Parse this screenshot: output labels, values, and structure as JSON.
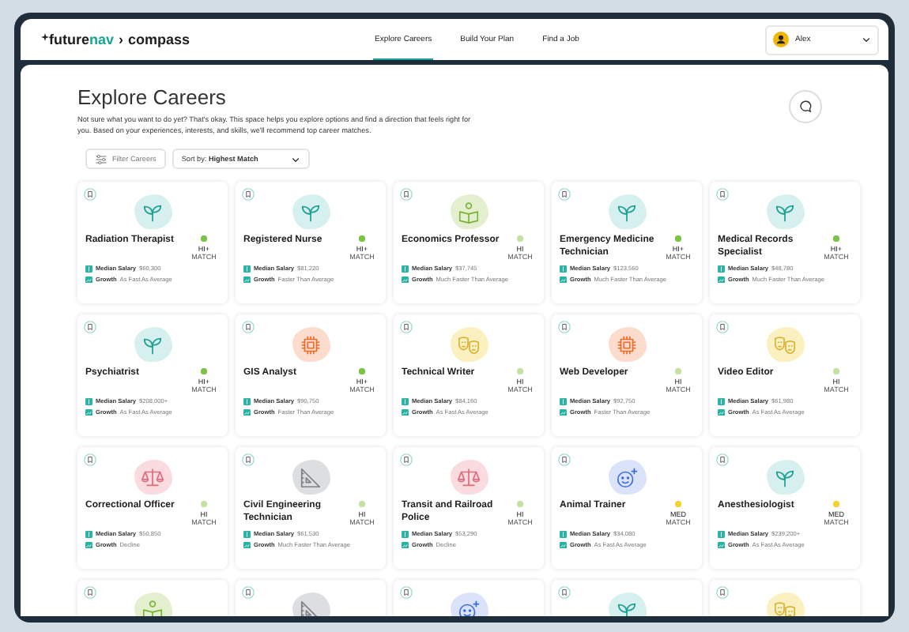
{
  "logo": {
    "name_start": "future",
    "name_accent": "nav",
    "separator": "›",
    "product": "compass"
  },
  "nav": [
    {
      "label": "Explore Careers",
      "selected": true
    },
    {
      "label": "Build Your Plan",
      "selected": false
    },
    {
      "label": "Find a Job",
      "selected": false
    }
  ],
  "user": {
    "name": "Alex"
  },
  "page": {
    "title": "Explore Careers",
    "description": "Not sure what you want to do yet? That's okay. This space helps you explore options and find a direction that feels right for you. Based on your experiences, interests, and skills, we'll recommend top career matches."
  },
  "toolbar": {
    "filter": "Filter Careers",
    "sort": "Sort by: **Highest Match**"
  },
  "careers": [
    {
      "kind": "sprout",
      "title": "Radiation Therapist",
      "match": "HI+",
      "match_label": "MATCH",
      "color": "#7cc242",
      "salary_label": "Median Salary",
      "salary": "$60,300",
      "growth_label": "Growth",
      "growth": "As Fast As Average"
    },
    {
      "kind": "sprout",
      "title": "Registered Nurse",
      "match": "HI+",
      "match_label": "MATCH",
      "color": "#7cc242",
      "salary_label": "Median Salary",
      "salary": "$81,220",
      "growth_label": "Growth",
      "growth": "Faster Than Average"
    },
    {
      "kind": "reader",
      "title": "Economics Professor",
      "match": "HI",
      "match_label": "MATCH",
      "color": "#c5e3a0",
      "salary_label": "Median Salary",
      "salary": "$37,745",
      "growth_label": "Growth",
      "growth": "Much Faster Than Average"
    },
    {
      "kind": "sprout",
      "title": "Emergency Medicine Technician",
      "match": "HI+",
      "match_label": "MATCH",
      "color": "#7cc242",
      "salary_label": "Median Salary",
      "salary": "$123,560",
      "growth_label": "Growth",
      "growth": "Much Faster Than Average"
    },
    {
      "kind": "sprout",
      "title": "Medical Records Specialist",
      "match": "HI+",
      "match_label": "MATCH",
      "color": "#7cc242",
      "salary_label": "Median Salary",
      "salary": "$48,780",
      "growth_label": "Growth",
      "growth": "Much Faster Than Average"
    },
    {
      "kind": "sprout",
      "title": "Psychiatrist",
      "match": "HI+",
      "match_label": "MATCH",
      "color": "#7cc242",
      "salary_label": "Median Salary",
      "salary": "$208,000+",
      "growth_label": "Growth",
      "growth": "As Fast As Average"
    },
    {
      "kind": "chip",
      "title": "GIS Analyst",
      "match": "HI+",
      "match_label": "MATCH",
      "color": "#7cc242",
      "salary_label": "Median Salary",
      "salary": "$90,750",
      "growth_label": "Growth",
      "growth": "Faster Than Average"
    },
    {
      "kind": "masks",
      "title": "Technical Writer",
      "match": "HI",
      "match_label": "MATCH",
      "color": "#c5e3a0",
      "salary_label": "Median Salary",
      "salary": "$84,160",
      "growth_label": "Growth",
      "growth": "As Fast As Average"
    },
    {
      "kind": "chip",
      "title": "Web Developer",
      "match": "HI",
      "match_label": "MATCH",
      "color": "#c5e3a0",
      "salary_label": "Median Salary",
      "salary": "$92,750",
      "growth_label": "Growth",
      "growth": "Faster Than Average"
    },
    {
      "kind": "masks",
      "title": "Video Editor",
      "match": "HI",
      "match_label": "MATCH",
      "color": "#c5e3a0",
      "salary_label": "Median Salary",
      "salary": "$61,980",
      "growth_label": "Growth",
      "growth": "As Fast As Average"
    },
    {
      "kind": "scales",
      "title": "Correctional Officer",
      "match": "HI",
      "match_label": "MATCH",
      "color": "#c5e3a0",
      "salary_label": "Median Salary",
      "salary": "$50,850",
      "growth_label": "Growth",
      "growth": "Decline"
    },
    {
      "kind": "ruler",
      "title": "Civil Engineering Technician",
      "match": "HI",
      "match_label": "MATCH",
      "color": "#c5e3a0",
      "salary_label": "Median Salary",
      "salary": "$61,530",
      "growth_label": "Growth",
      "growth": "Much Faster Than Average"
    },
    {
      "kind": "scales",
      "title": "Transit and Railroad Police",
      "match": "HI",
      "match_label": "MATCH",
      "color": "#c5e3a0",
      "salary_label": "Median Salary",
      "salary": "$53,290",
      "growth_label": "Growth",
      "growth": "Decline"
    },
    {
      "kind": "smiley",
      "title": "Animal Trainer",
      "match": "MED",
      "match_label": "MATCH",
      "color": "#f5d130",
      "salary_label": "Median Salary",
      "salary": "$34,080",
      "growth_label": "Growth",
      "growth": "As Fast As Average"
    },
    {
      "kind": "sprout",
      "title": "Anesthesiologist",
      "match": "MED",
      "match_label": "MATCH",
      "color": "#f5d130",
      "salary_label": "Median Salary",
      "salary": "$239,200+",
      "growth_label": "Growth",
      "growth": "As Fast As Average"
    },
    {
      "kind": "reader"
    },
    {
      "kind": "ruler"
    },
    {
      "kind": "smiley"
    },
    {
      "kind": "sprout"
    },
    {
      "kind": "masks"
    }
  ]
}
